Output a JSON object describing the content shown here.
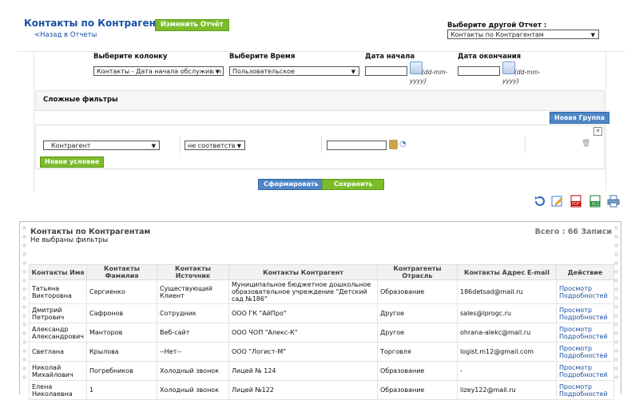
{
  "header": {
    "title": "Контакты по Контрагентам",
    "edit_report": "Изменить Отчёт",
    "back_link": "<Назад в Отчеты",
    "other_report_label": "Выберите другой Отчет :",
    "other_report_value": "Контакты по Контрагентам"
  },
  "filters": {
    "column_label": "Выберите колонку",
    "column_value": "Контакты - Дата начала обслуживан",
    "time_label": "Выберите Время",
    "time_value": "Пользовательское",
    "start_label": "Дата начала",
    "end_label": "Дата окончания",
    "date_format_1": "(dd-mm-",
    "date_format_2": "yyyy)",
    "complex_filters": "Сложные фильтры",
    "new_group": "Новая Группа",
    "condition_field": "Контрагент",
    "condition_op": "не соответств",
    "new_condition": "Новое условие",
    "generate": "Сформировать",
    "save": "Сохранить"
  },
  "toolbar_icons": [
    "refresh-icon",
    "edit-icon",
    "pdf-icon",
    "excel-icon",
    "print-icon"
  ],
  "report": {
    "title": "Контакты по Контрагентам",
    "no_filters": "Не выбраны фильтры",
    "total": "Всего : 66 Записи",
    "columns": [
      "Контакты Имя",
      "Контакты Фамилия",
      "Контакты Источник",
      "Контакты Контрагент",
      "Контрагенты Отрасль",
      "Контакты Адрес E-mail",
      "Действие"
    ],
    "rows": [
      [
        "Татьяна Викторовна",
        "Сергиенко",
        "Существующий Клиент",
        "Муниципальное бюджетное дошкольное образовательное учреждение \"Детский сад №186\"",
        "Образование",
        "186detsad@mail.ru",
        "Просмотр Подробностей"
      ],
      [
        "Дмитрий Петрович",
        "Сафронов",
        "Сотрудник",
        "ООО ГК \"АйПро\"",
        "Другое",
        "sales@iprogc.ru",
        "Просмотр Подробностей"
      ],
      [
        "Александр Александрович",
        "Манторов",
        "Веб-сайт",
        "ООО ЧОП \"Алекс-К\"",
        "Другое",
        "ohrana-alekc@mail.ru",
        "Просмотр Подробностей"
      ],
      [
        "Светлана",
        "Крылова",
        "--Нет--",
        "ООО \"Логист-М\"",
        "Торговля",
        "logist.m12@gmail.com",
        "Просмотр Подробностей"
      ],
      [
        "Николай Михайлович",
        "Погребников",
        "Холодный звонок",
        "Лицей № 124",
        "Образование",
        "-",
        "Просмотр Подробностей"
      ],
      [
        "Елена Николаевна",
        "1",
        "Холодный звонок",
        "Лицей №122",
        "Образование",
        "lizey122@mail.ru",
        "Просмотр Подробностей"
      ]
    ]
  },
  "colors": {
    "brand_blue": "#1a4fa3",
    "green_button": "#7cbc2a",
    "blue_button": "#4f86c6"
  }
}
